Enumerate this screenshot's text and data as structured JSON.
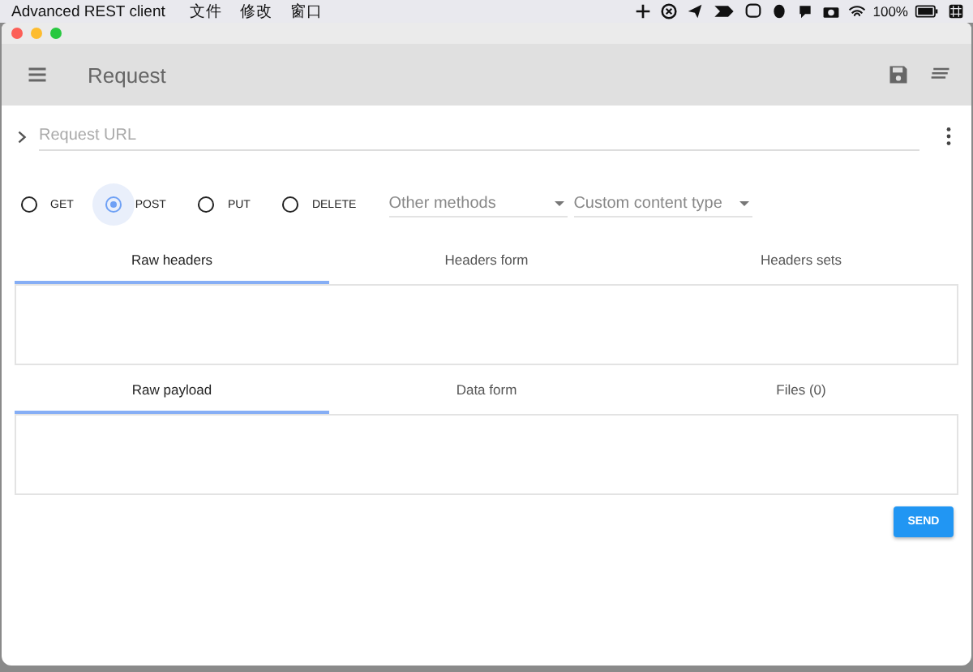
{
  "menubar": {
    "app": "Advanced REST client",
    "menus": [
      "文件",
      "修改",
      "窗口"
    ],
    "battery": "100%"
  },
  "toolbar": {
    "title": "Request"
  },
  "url": {
    "placeholder": "Request URL"
  },
  "methods": [
    {
      "label": "GET",
      "selected": false
    },
    {
      "label": "POST",
      "selected": true
    },
    {
      "label": "PUT",
      "selected": false
    },
    {
      "label": "DELETE",
      "selected": false
    }
  ],
  "dropdowns": [
    {
      "placeholder": "Other methods"
    },
    {
      "placeholder": "Custom content type"
    }
  ],
  "header_tabs": [
    {
      "label": "Raw headers",
      "selected": true
    },
    {
      "label": "Headers form",
      "selected": false
    },
    {
      "label": "Headers sets",
      "selected": false
    }
  ],
  "payload_tabs": [
    {
      "label": "Raw payload",
      "selected": true
    },
    {
      "label": "Data form",
      "selected": false
    },
    {
      "label": "Files (0)",
      "selected": false
    }
  ],
  "send_button": "SEND"
}
